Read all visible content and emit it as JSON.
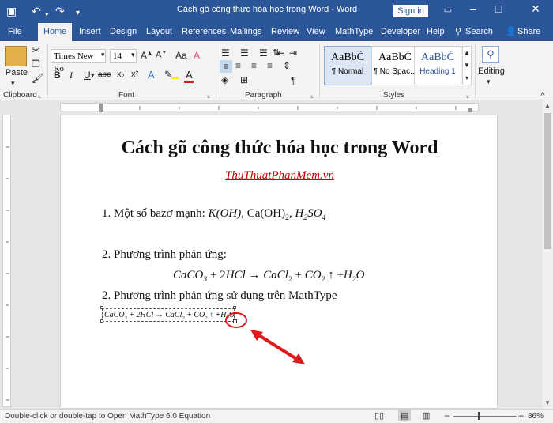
{
  "window": {
    "title": "Cách gõ công thức hóa học trong Word  -  Word",
    "signin": "Sign in"
  },
  "tabs": [
    {
      "label": "File"
    },
    {
      "label": "Home"
    },
    {
      "label": "Insert"
    },
    {
      "label": "Design"
    },
    {
      "label": "Layout"
    },
    {
      "label": "References"
    },
    {
      "label": "Mailings"
    },
    {
      "label": "Review"
    },
    {
      "label": "View"
    },
    {
      "label": "MathType"
    },
    {
      "label": "Developer"
    },
    {
      "label": "Help"
    }
  ],
  "search_label": "Search",
  "share_label": "Share",
  "ribbon": {
    "paste": "Paste",
    "font_name": "Times New Ro",
    "font_size": "14",
    "bold": "B",
    "italic": "I",
    "underline": "U",
    "strike": "abc",
    "styles": [
      {
        "preview": "AaBbĆ",
        "name": "¶ Normal"
      },
      {
        "preview": "AaBbĆ",
        "name": "¶ No Spac..."
      },
      {
        "preview": "AaBbĆ",
        "name": "Heading 1"
      }
    ],
    "editing": "Editing",
    "groups": {
      "clipboard": "Clipboard",
      "font": "Font",
      "paragraph": "Paragraph",
      "styles": "Styles"
    }
  },
  "document": {
    "title": "Cách gõ công thức hóa học trong Word",
    "link": "ThuThuatPhanMem.vn",
    "item1_text": "1. Một số bazơ mạnh: ",
    "item2_heading": "2. Phương trình phản ứng:",
    "item3_heading": "2. Phương trình phản ứng sử dụng trên MathType"
  },
  "status": {
    "text": "Double-click or double-tap to Open MathType 6.0 Equation",
    "zoom": "86%"
  },
  "colors": {
    "word_blue": "#2b579a",
    "link_red": "#c00000",
    "annotation_red": "#e0191b"
  }
}
